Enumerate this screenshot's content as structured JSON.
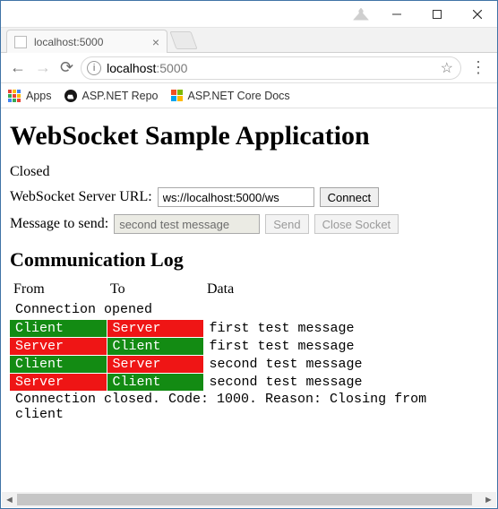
{
  "window": {
    "tab_title": "localhost:5000",
    "url_host": "localhost",
    "url_rest": ":5000"
  },
  "bookmarks": {
    "apps": "Apps",
    "repo": "ASP.NET Repo",
    "docs": "ASP.NET Core Docs"
  },
  "page": {
    "heading": "WebSocket Sample Application",
    "state": "Closed",
    "url_label": "WebSocket Server URL:",
    "url_value": "ws://localhost:5000/ws",
    "connect": "Connect",
    "msg_label": "Message to send:",
    "msg_value": "second test message",
    "send": "Send",
    "close": "Close Socket",
    "log_heading": "Communication Log",
    "cols": {
      "from": "From",
      "to": "To",
      "data": "Data"
    },
    "opened": "Connection opened",
    "client": "Client",
    "server": "Server",
    "rows": [
      {
        "from": "client",
        "to": "server",
        "data": "first test message"
      },
      {
        "from": "server",
        "to": "client",
        "data": "first test message"
      },
      {
        "from": "client",
        "to": "server",
        "data": "second test message"
      },
      {
        "from": "server",
        "to": "client",
        "data": "second test message"
      }
    ],
    "closed": "Connection closed. Code: 1000. Reason: Closing from client"
  }
}
